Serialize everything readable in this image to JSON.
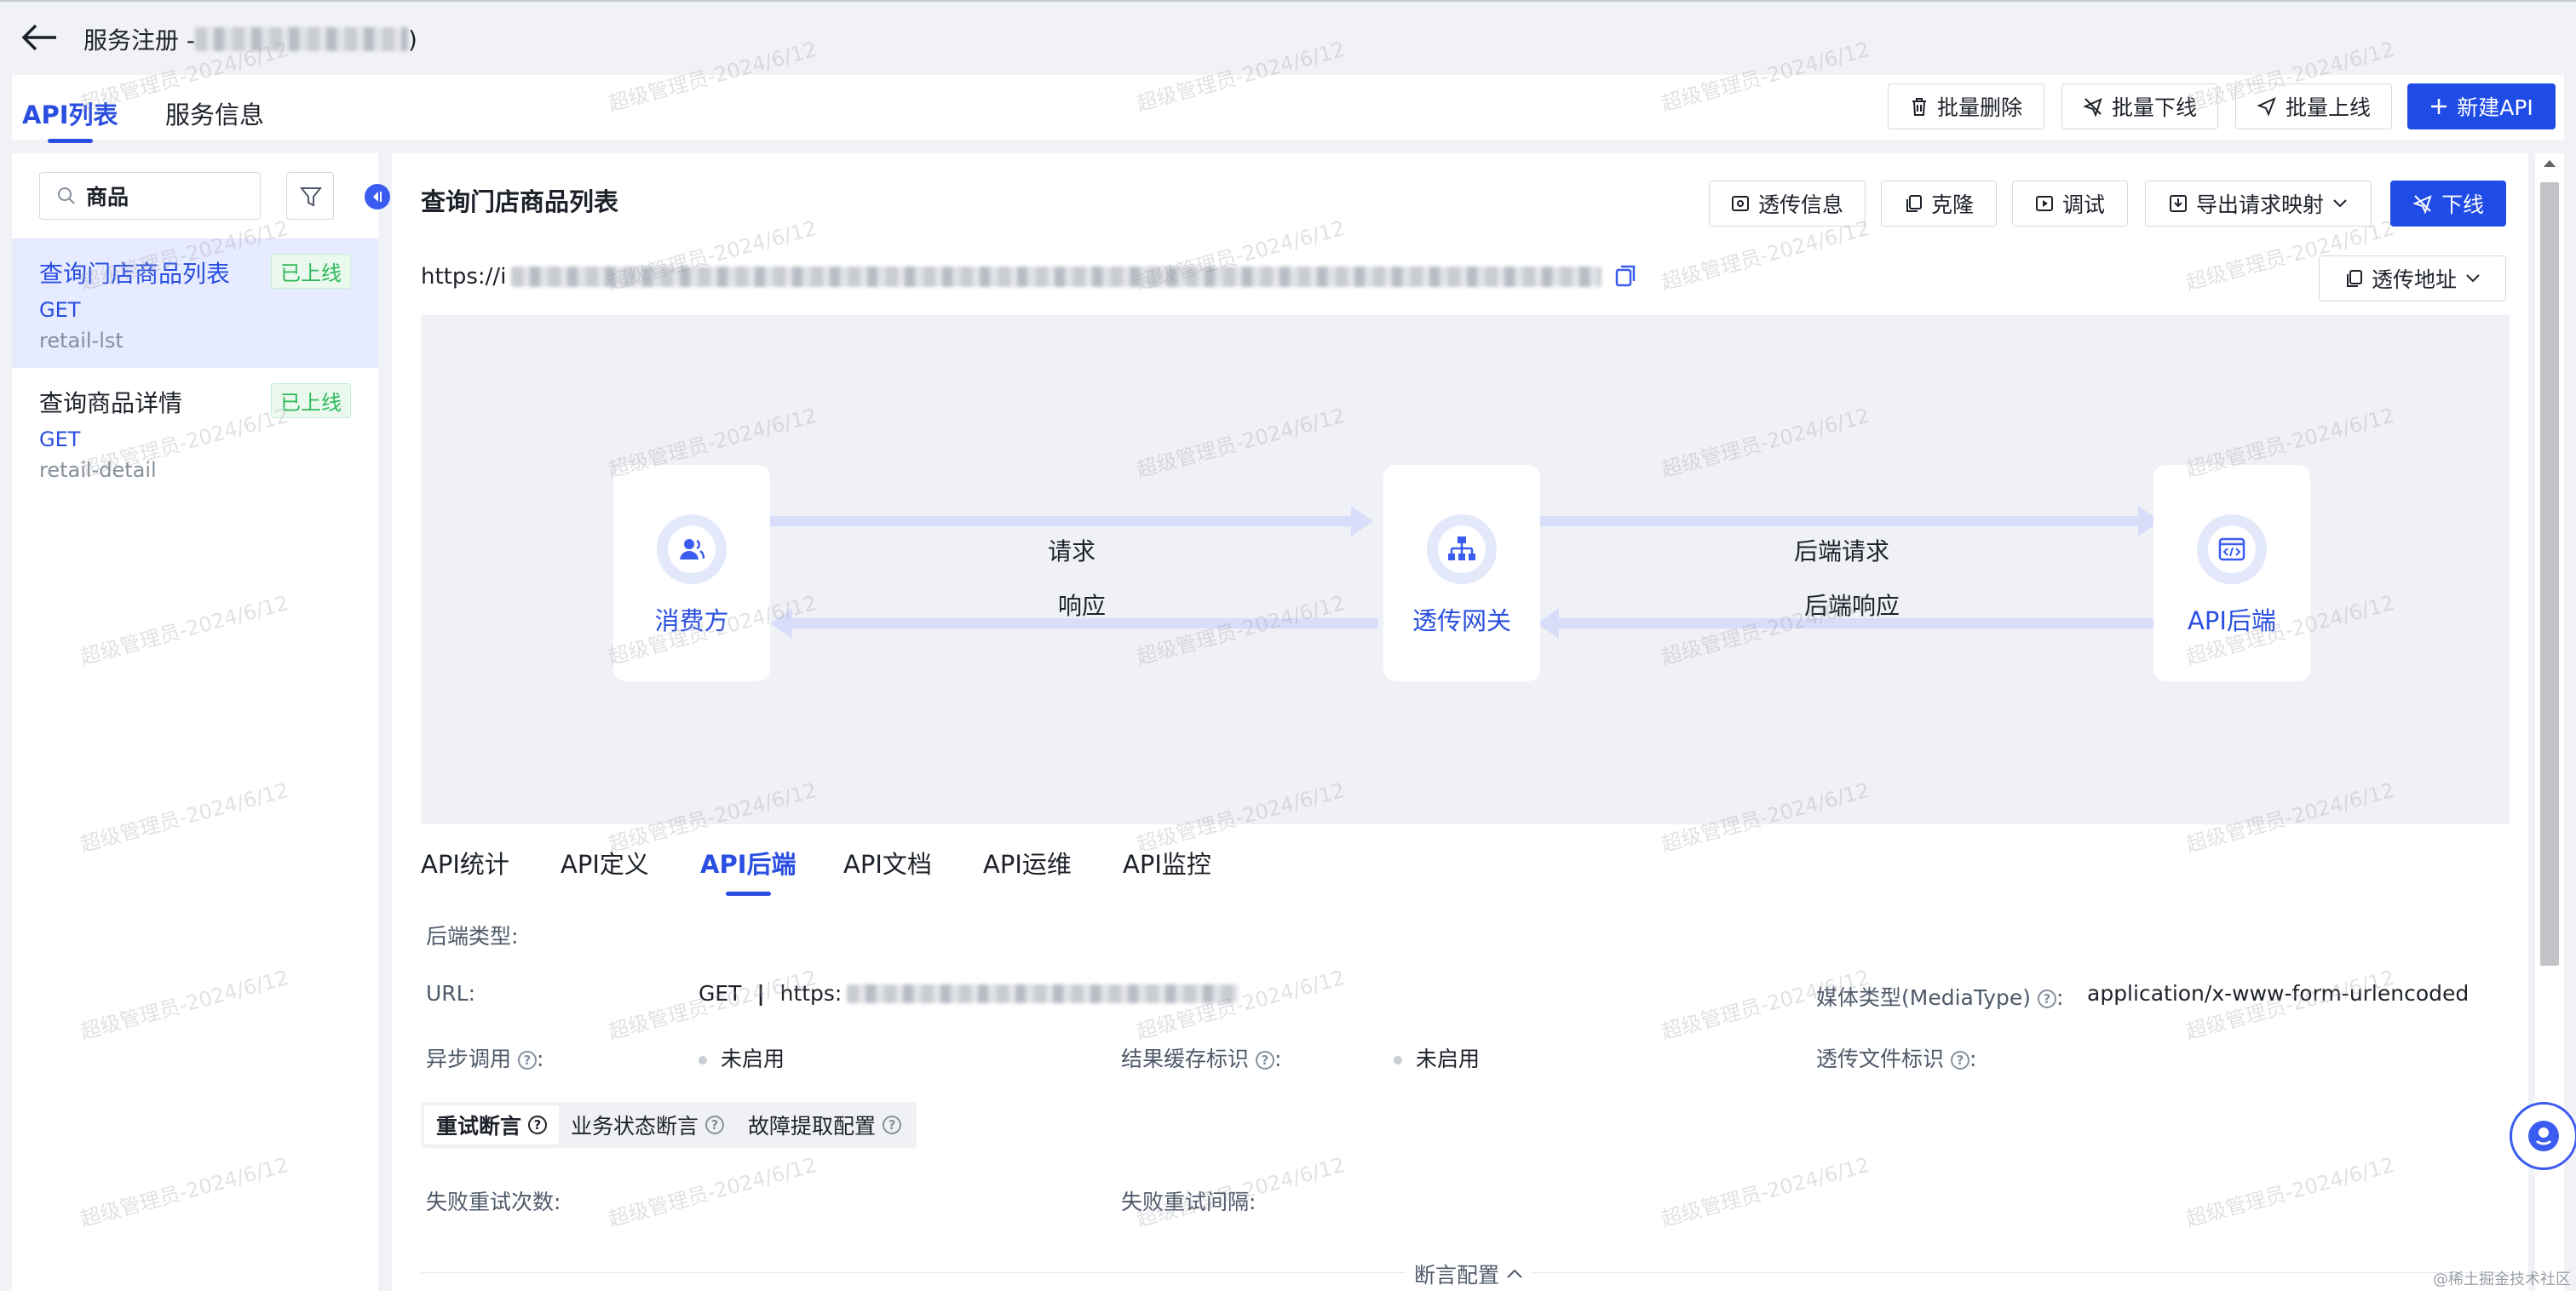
{
  "header": {
    "title_prefix": "服务注册 - ",
    "title_suffix": ")"
  },
  "top_tabs": [
    {
      "label": "API列表"
    },
    {
      "label": "服务信息"
    }
  ],
  "toolbar": {
    "batch_delete": "批量删除",
    "batch_offline": "批量下线",
    "batch_online": "批量上线",
    "new_api": "新建API"
  },
  "sidebar": {
    "search_value": "商品",
    "items": [
      {
        "name": "查询门店商品列表",
        "method": "GET",
        "path": "retail-lst",
        "status": "已上线"
      },
      {
        "name": "查询商品详情",
        "method": "GET",
        "path": "retail-detail",
        "status": "已上线"
      }
    ]
  },
  "main": {
    "title": "查询门店商品列表",
    "url_prefix": "https://i",
    "actions": {
      "passthrough_info": "透传信息",
      "clone": "克隆",
      "debug": "调试",
      "export": "导出请求映射",
      "offline": "下线",
      "passthrough_addr": "透传地址"
    },
    "flow": {
      "consumer": "消费方",
      "gateway": "透传网关",
      "backend": "API后端",
      "request": "请求",
      "response": "响应",
      "backend_request": "后端请求",
      "backend_response": "后端响应"
    },
    "sub_tabs": [
      {
        "label": "API统计"
      },
      {
        "label": "API定义"
      },
      {
        "label": "API后端"
      },
      {
        "label": "API文档"
      },
      {
        "label": "API运维"
      },
      {
        "label": "API监控"
      }
    ],
    "details": {
      "backend_type_label": "后端类型:",
      "url_label": "URL:",
      "url_method": "GET",
      "url_sep": "|",
      "url_prefix": "https:",
      "media_label": "媒体类型(MediaType)",
      "media_value": "application/x-www-form-urlencoded",
      "async_label": "异步调用",
      "async_value": "未启用",
      "cache_label": "结果缓存标识",
      "cache_value": "未启用",
      "file_label": "透传文件标识",
      "colon": ":",
      "retry_count_label": "失败重试次数:",
      "retry_interval_label": "失败重试间隔:"
    },
    "segments": [
      {
        "label": "重试断言"
      },
      {
        "label": "业务状态断言"
      },
      {
        "label": "故障提取配置"
      }
    ],
    "footer": "断言配置"
  },
  "watermark": "超级管理员-2024/6/12",
  "corner_text": "@稀土掘金技术社区"
}
